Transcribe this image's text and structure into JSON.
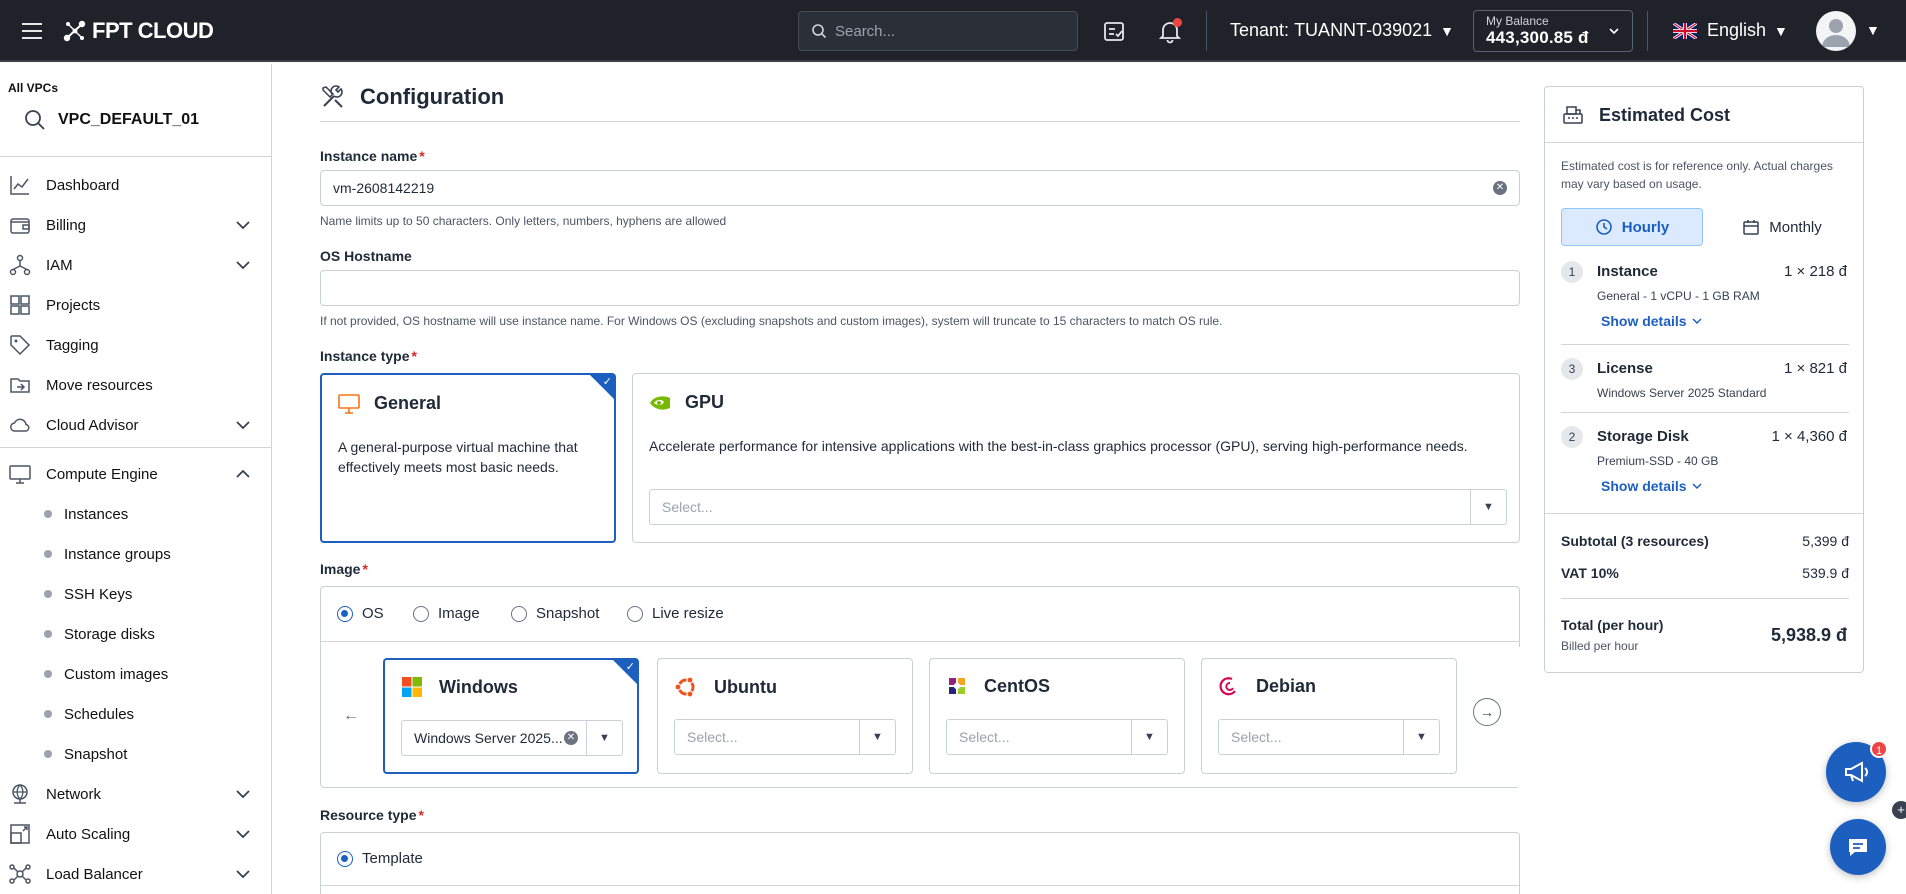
{
  "topbar": {
    "logo_text": "FPT CLOUD",
    "search_placeholder": "Search...",
    "tenant_label": "Tenant:",
    "tenant_value": "TUANNT-039021",
    "balance_label": "My Balance",
    "balance_value": "443,300.85 đ",
    "language": "English"
  },
  "sidebar": {
    "vpc_label": "All VPCs",
    "vpc_name": "VPC_DEFAULT_01",
    "items": {
      "dashboard": "Dashboard",
      "billing": "Billing",
      "iam": "IAM",
      "projects": "Projects",
      "tagging": "Tagging",
      "move_resources": "Move resources",
      "cloud_advisor": "Cloud Advisor",
      "compute_engine": "Compute Engine",
      "network": "Network",
      "auto_scaling": "Auto Scaling",
      "load_balancer": "Load Balancer"
    },
    "compute_sub": {
      "instances": "Instances",
      "instance_groups": "Instance groups",
      "ssh_keys": "SSH Keys",
      "storage_disks": "Storage disks",
      "custom_images": "Custom images",
      "schedules": "Schedules",
      "snapshot": "Snapshot"
    }
  },
  "config": {
    "title": "Configuration",
    "instance_name_label": "Instance name",
    "instance_name_value": "vm-2608142219",
    "instance_name_help": "Name limits up to 50 characters. Only letters, numbers, hyphens are allowed",
    "hostname_label": "OS Hostname",
    "hostname_value": "",
    "hostname_help": "If not provided, OS hostname will use instance name. For Windows OS (excluding snapshots and custom images), system will truncate to 15 characters to match OS rule.",
    "instance_type_label": "Instance type",
    "general_title": "General",
    "general_desc": "A general-purpose virtual machine that effectively meets most basic needs.",
    "gpu_title": "GPU",
    "gpu_desc": "Accelerate performance for intensive applications with the best-in-class graphics processor (GPU), serving high-performance needs.",
    "gpu_select_placeholder": "Select...",
    "image_label": "Image",
    "image_tabs": {
      "os": "OS",
      "image": "Image",
      "snapshot": "Snapshot",
      "live_resize": "Live resize"
    },
    "os_cards": {
      "windows": {
        "name": "Windows",
        "value": "Windows Server 2025..."
      },
      "ubuntu": {
        "name": "Ubuntu",
        "placeholder": "Select..."
      },
      "centos": {
        "name": "CentOS",
        "placeholder": "Select..."
      },
      "debian": {
        "name": "Debian",
        "placeholder": "Select..."
      }
    },
    "resource_type_label": "Resource type",
    "resource_template": "Template"
  },
  "cost": {
    "title": "Estimated Cost",
    "note": "Estimated cost is for reference only. Actual charges may vary based on usage.",
    "hourly": "Hourly",
    "monthly": "Monthly",
    "items": [
      {
        "num": "1",
        "name": "Instance",
        "price": "1 × 218 đ",
        "desc": "General - 1 vCPU - 1 GB RAM",
        "link": "Show details"
      },
      {
        "num": "3",
        "name": "License",
        "price": "1 × 821 đ",
        "desc": "Windows Server 2025 Standard"
      },
      {
        "num": "2",
        "name": "Storage Disk",
        "price": "1 × 4,360 đ",
        "desc": "Premium-SSD - 40 GB",
        "link": "Show details"
      }
    ],
    "subtotal_label": "Subtotal (3 resources)",
    "subtotal_value": "5,399 đ",
    "vat_label": "VAT 10%",
    "vat_value": "539.9 đ",
    "total_label": "Total (per hour)",
    "total_sub": "Billed per hour",
    "total_value": "5,938.9 đ"
  },
  "fab": {
    "announce_badge": "1"
  }
}
